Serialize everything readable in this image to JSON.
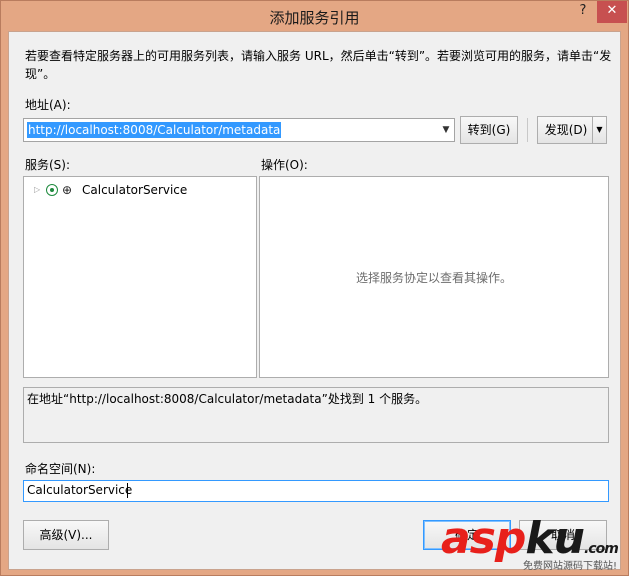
{
  "window": {
    "title": "添加服务引用",
    "help_label": "?",
    "close_label": "✕"
  },
  "description": "若要查看特定服务器上的可用服务列表，请输入服务 URL，然后单击“转到”。若要浏览可用的服务，请单击“发现”。",
  "address": {
    "label": "地址(A):",
    "value": "http://localhost:8008/Calculator/metadata",
    "go_label": "转到(G)",
    "discover_label": "发现(D)"
  },
  "services": {
    "label": "服务(S):",
    "items": [
      {
        "label": "CalculatorService",
        "icon": "service-icon"
      }
    ]
  },
  "operations": {
    "label": "操作(O):",
    "message": "选择服务协定以查看其操作。"
  },
  "status_text": "在地址“http://localhost:8008/Calculator/metadata”处找到 1 个服务。",
  "namespace": {
    "label": "命名空间(N):",
    "value": "CalculatorService"
  },
  "buttons": {
    "advanced": "高级(V)...",
    "ok": "确定",
    "cancel": "取消"
  },
  "watermark": {
    "brand_red": "asp",
    "brand_dark": "ku",
    "brand_suffix": ".com",
    "tagline": "免费网站源码下载站!"
  },
  "colors": {
    "title_bar": "#e4a784",
    "selection": "#3399ff",
    "close_button": "#c75050"
  }
}
